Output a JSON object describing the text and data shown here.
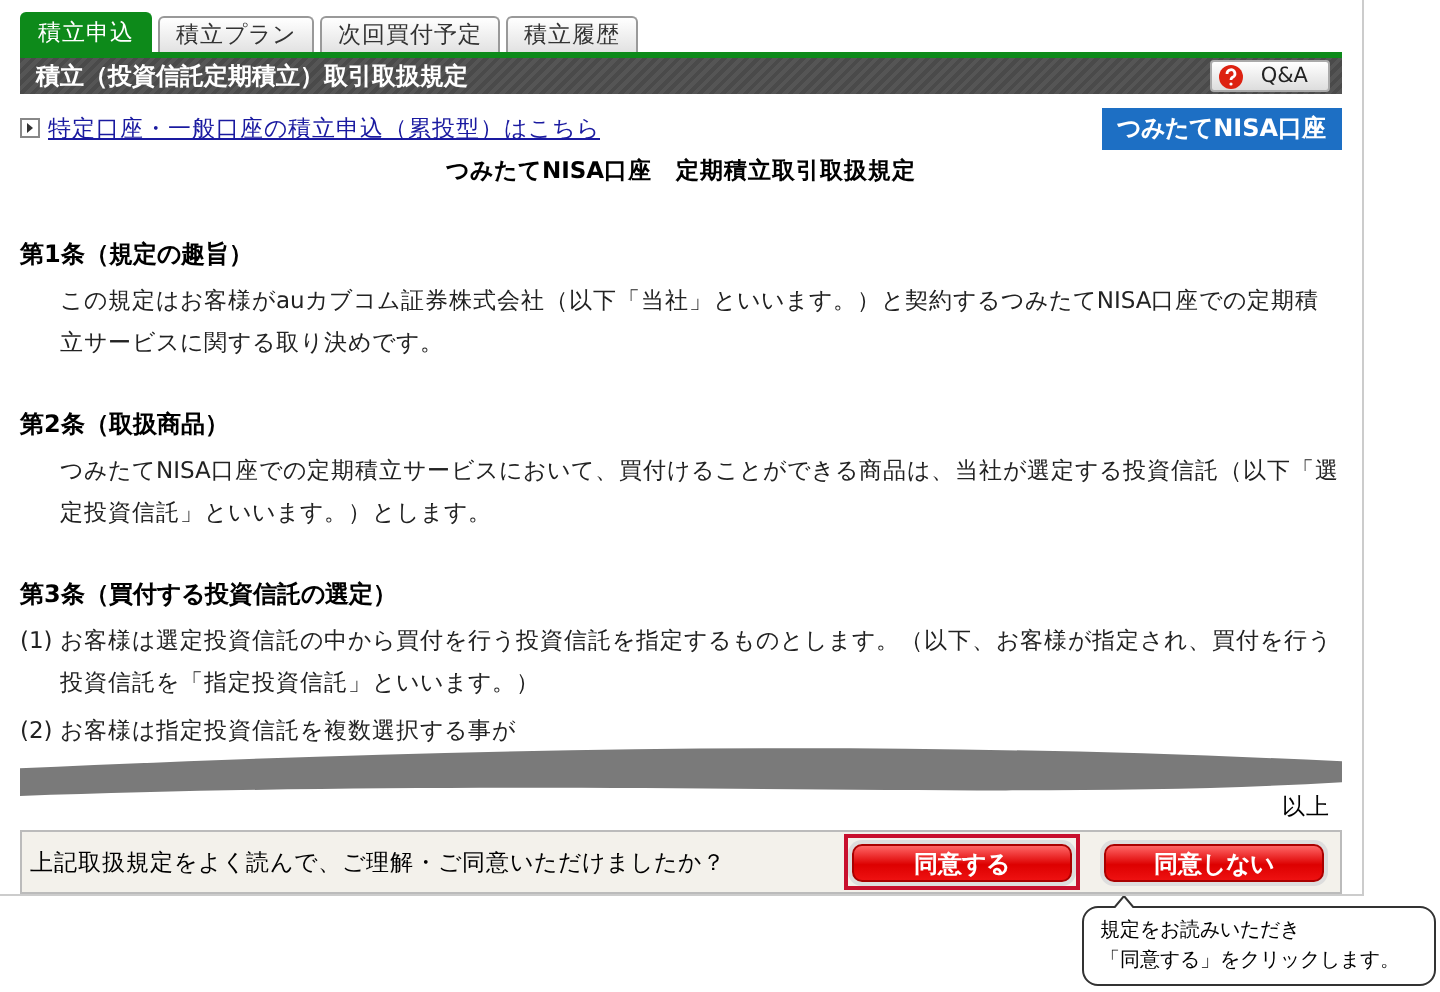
{
  "tabs": [
    {
      "label": "積立申込",
      "selected": true
    },
    {
      "label": "積立プラン",
      "selected": false
    },
    {
      "label": "次回買付予定",
      "selected": false
    },
    {
      "label": "積立履歴",
      "selected": false
    }
  ],
  "header": {
    "title": "積立（投資信託定期積立）取引取扱規定",
    "qa_button": "Q&A"
  },
  "link": "特定口座・一般口座の積立申込（累投型）はこちら",
  "account_badge": "つみたてNISA口座",
  "doc_title": "つみたてNISA口座　定期積立取引取扱規定",
  "articles": [
    {
      "heading": "第1条（規定の趣旨）",
      "paragraphs": [
        {
          "text": "この規定はお客様がauカブコム証券株式会社（以下「当社」といいます。）と契約するつみたてNISA口座での定期積立サービスに関する取り決めです。"
        }
      ]
    },
    {
      "heading": "第2条（取扱商品）",
      "paragraphs": [
        {
          "text": "つみたてNISA口座での定期積立サービスにおいて、買付けることができる商品は、当社が選定する投資信託（以下「選定投資信託」といいます。）とします。"
        }
      ]
    },
    {
      "heading": "第3条（買付する投資信託の選定）",
      "paragraphs": [
        {
          "marker": "(1)",
          "text": "お客様は選定投資信託の中から買付を行う投資信託を指定するものとします。（以下、お客様が指定され、買付を行う投資信託を「指定投資信託」といいます。）"
        },
        {
          "marker": "(2)",
          "text": "お客様は指定投資信託を複数選択する事が"
        }
      ]
    }
  ],
  "closing": "以上",
  "confirm": {
    "question": "上記取扱規定をよく読んで、ご理解・ご同意いただけましたか？",
    "buttons": [
      {
        "label": "同意する",
        "highlighted": true
      },
      {
        "label": "同意しない",
        "highlighted": false
      }
    ]
  },
  "callout": {
    "lines": [
      "規定をお読みいただき",
      "「同意する」をクリックします。"
    ]
  }
}
